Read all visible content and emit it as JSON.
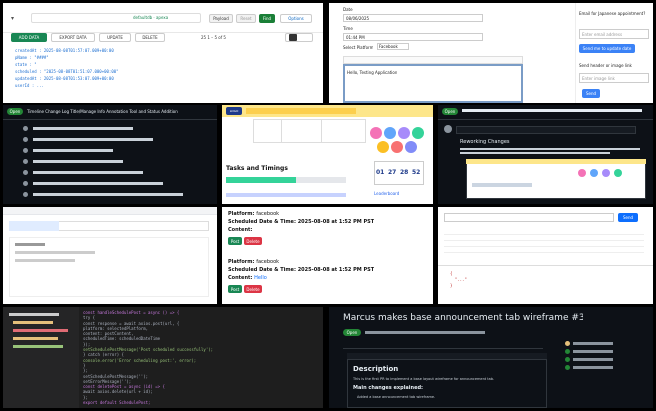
{
  "t1": {
    "db_name": "defaultdb · apexa",
    "btn_payload": "Payload",
    "btn_reset": "Reset",
    "btn_find": "Find",
    "btn_options": "Options",
    "add_data": "ADD DATA",
    "export_data": "EXPORT DATA",
    "update": "UPDATE",
    "delete": "DELETE",
    "pager": "25   1 – 5 of 5",
    "fields": [
      "createdAt : 2025-08-08T01:57:07.009+00:00",
      "pName : \"####\"",
      "state : \"",
      "scheduled : \"2025-08-08T01:51:07.000+00:00\"",
      "updatedAt : 2025-08-08T01:53:07.009+00:00",
      "userId : ..."
    ]
  },
  "t2": {
    "date_label": "Date",
    "date_value": "08/06/2025",
    "time_label": "Time",
    "time_value": "01:44 PM",
    "platform_label": "Select Platform",
    "platform_value": "Facebook",
    "content": "Hello, Testing Application",
    "email_title": "Email for Japanese appointment?",
    "email_placeholder": "Enter email address",
    "email_btn": "Send me to update date",
    "image_title": "Send header or image link",
    "image_placeholder": "Enter image link",
    "image_btn": "Send"
  },
  "t3": {
    "header": "Timeline Change Log Title/Manage Info Annotation Tool and Status Addition",
    "lines": [
      "",
      "",
      "",
      "",
      "",
      "",
      ""
    ]
  },
  "t4": {
    "table_heads": [
      "",
      "",
      "",
      "",
      ""
    ],
    "section_title": "Tasks and Timings",
    "timer_digits": [
      "01",
      "27",
      "28",
      "52"
    ],
    "footer_links": [
      "",
      "",
      "",
      ""
    ],
    "leaderboard": "Leaderboard"
  },
  "t5": {
    "title": "Reworking Changes",
    "body": "",
    "btn": "Share"
  },
  "t6": {
    "tabs": [
      "",
      "",
      "",
      ""
    ]
  },
  "t7": {
    "platform_label": "Platform:",
    "platform_value": "facebook",
    "sched_label": "Scheduled Date & Time:",
    "sched_value": "2025-08-08 at 1:52 PM PST",
    "content_label": "Content:",
    "content_value": "Hello",
    "post_btn": "Post",
    "delete_btn": "Delete"
  },
  "t8": {
    "url": "",
    "btn": "Send",
    "rows": [
      "",
      "",
      "",
      "",
      "",
      "",
      ""
    ]
  },
  "t9": {
    "tree": [
      "",
      "",
      "",
      "",
      ""
    ],
    "code": [
      "const handleSchedulePost = async () => {",
      "  try {",
      "    const response = await axios.post(url, {",
      "      platform: selectedPlatform,",
      "      content: postContent,",
      "      scheduledTime: scheduledDateTime",
      "    });",
      "    setSchedulePostMessage('Post scheduled successfully');",
      "  } catch (error) {",
      "    console.error('Error scheduling post:', error);",
      "  }",
      "};",
      "setSchedulePostMessage('');",
      "setErrorMessage('');",
      "const deletePost = async (id) => {",
      "  await axios.delete(url + id);",
      "};",
      "export default SchedulePost;"
    ]
  },
  "t10": {
    "title": "Marcus makes base announcement tab wireframe #3866",
    "badge": "Open",
    "description": "Description",
    "desc_text": "This is the first PR to implement a base layout wireframe for announcement tab.",
    "main_changes": "Main changes explained:",
    "bullet": "Added a base announcement tab wireframe."
  },
  "colors": {
    "green": "#198754",
    "blue": "#0d6efd",
    "red": "#dc3545",
    "gh_dark": "#0d1117",
    "gh_green": "#238636"
  }
}
